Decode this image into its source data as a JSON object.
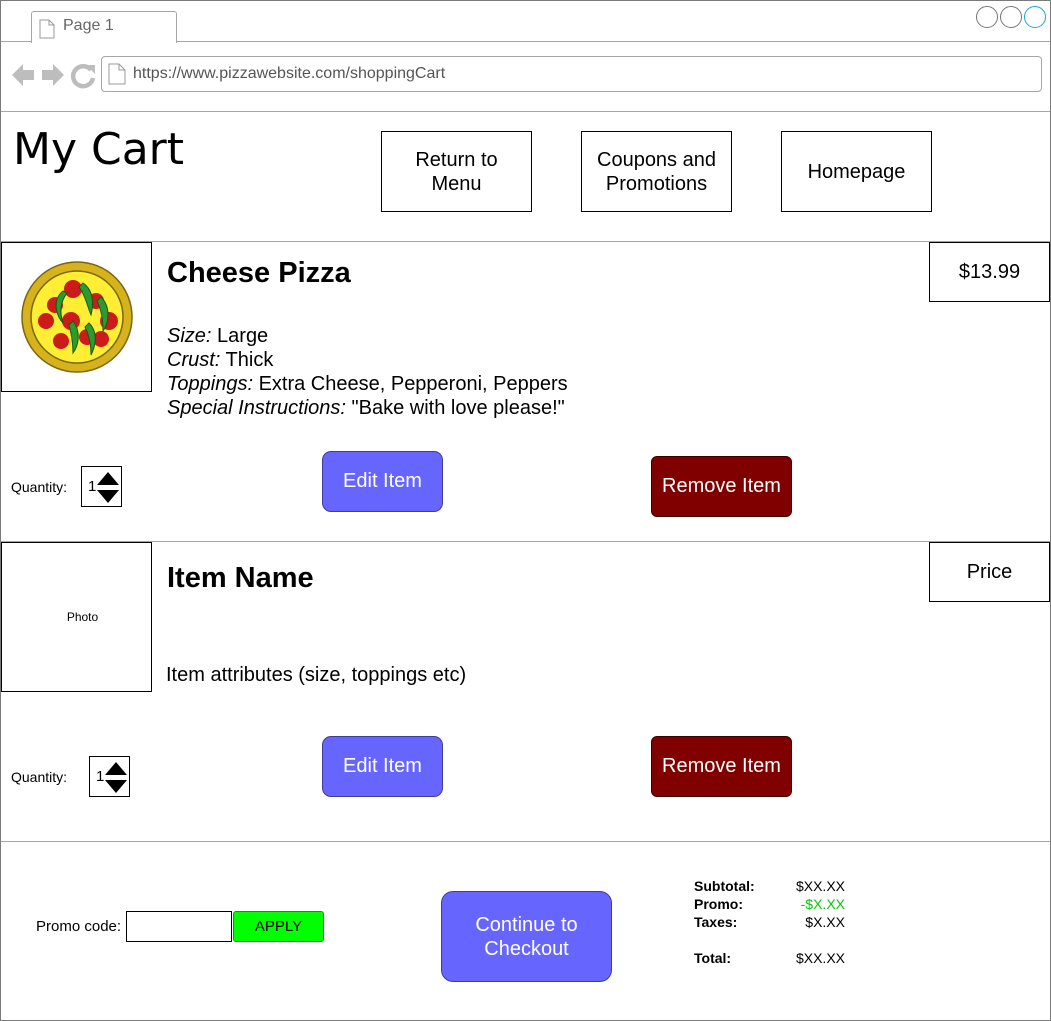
{
  "browser": {
    "tab_title": "Page 1",
    "url": "https://www.pizzawebsite.com/shoppingCart"
  },
  "header": {
    "title": "My Cart",
    "buttons": [
      {
        "label": "Return to Menu"
      },
      {
        "label": "Coupons and Promotions"
      },
      {
        "label": "Homepage"
      }
    ]
  },
  "items": [
    {
      "name": "Cheese Pizza",
      "price": "$13.99",
      "attributes": [
        {
          "key": "Size:",
          "value": "Large"
        },
        {
          "key": "Crust:",
          "value": "Thick"
        },
        {
          "key": "Toppings:",
          "value": "Extra Cheese, Pepperoni, Peppers"
        },
        {
          "key": "Special Instructions:",
          "value": "\"Bake with love please!\""
        }
      ],
      "quantity_label": "Quantity:",
      "quantity": "1",
      "edit_label": "Edit Item",
      "remove_label": "Remove Item",
      "photo_icon": "pizza-icon"
    },
    {
      "name": "Item Name",
      "price": "Price",
      "photo_label": "Photo",
      "attributes_text": "Item attributes (size, toppings etc)",
      "quantity_label": "Quantity:",
      "quantity": "1",
      "edit_label": "Edit Item",
      "remove_label": "Remove Item"
    }
  ],
  "footer": {
    "promo_label": "Promo code:",
    "promo_value": "",
    "apply_label": "APPLY",
    "checkout_label": "Continue to Checkout",
    "summary": {
      "subtotal_label": "Subtotal:",
      "subtotal_value": "$XX.XX",
      "promo_label": "Promo:",
      "promo_value": "-$X.XX",
      "taxes_label": "Taxes:",
      "taxes_value": "$X.XX",
      "total_label": "Total:",
      "total_value": "$XX.XX"
    }
  },
  "colors": {
    "accent_button": "#6666ff",
    "remove_button": "#800000",
    "apply_button": "#00ff00",
    "promo_discount": "#00cc00"
  }
}
